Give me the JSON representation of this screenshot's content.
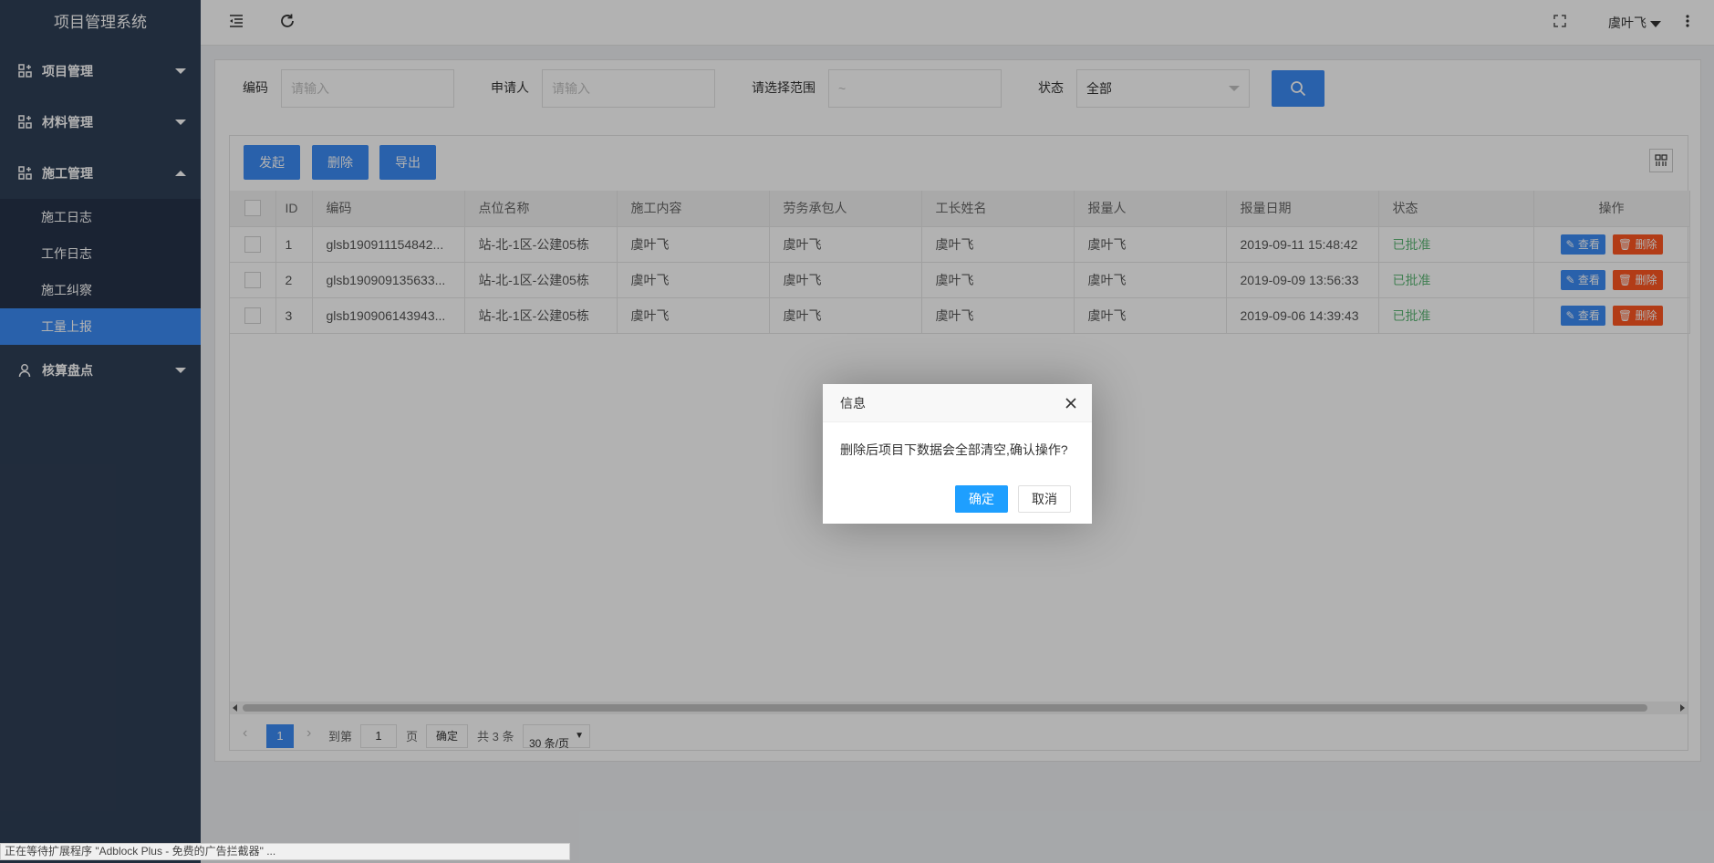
{
  "sidebar": {
    "brand": "项目管理系统",
    "groups": [
      {
        "label": "项目管理",
        "expanded": false,
        "icon": "grid-plus-icon"
      },
      {
        "label": "材料管理",
        "expanded": false,
        "icon": "grid-plus-icon"
      },
      {
        "label": "施工管理",
        "expanded": true,
        "icon": "grid-plus-icon"
      },
      {
        "label": "核算盘点",
        "expanded": false,
        "icon": "user-icon"
      }
    ],
    "sub_items": [
      {
        "label": "施工日志",
        "active": false
      },
      {
        "label": "工作日志",
        "active": false
      },
      {
        "label": "施工纠察",
        "active": false
      },
      {
        "label": "工量上报",
        "active": true
      }
    ]
  },
  "header": {
    "menu_toggle_icon": "menu-collapse-icon",
    "refresh_icon": "refresh-icon",
    "fullscreen_icon": "fullscreen-icon",
    "user_name": "虞叶飞",
    "more_icon": "more-vertical-icon"
  },
  "filters": {
    "code_label": "编码",
    "code_placeholder": "请输入",
    "applicant_label": "申请人",
    "applicant_placeholder": "请输入",
    "range_label": "请选择范围",
    "range_placeholder": "~",
    "status_label": "状态",
    "status_value": "全部"
  },
  "toolbar": {
    "launch_label": "发起",
    "delete_label": "删除",
    "export_label": "导出"
  },
  "table": {
    "headers": {
      "id": "ID",
      "code": "编码",
      "location": "点位名称",
      "content": "施工内容",
      "contractor": "劳务承包人",
      "foreman": "工长姓名",
      "reporter": "报量人",
      "date": "报量日期",
      "status": "状态",
      "actions": "操作"
    },
    "rows": [
      {
        "id": "1",
        "code": "glsb190911154842...",
        "location": "站-北-1区-公建05栋",
        "content": "虞叶飞",
        "contractor": "虞叶飞",
        "foreman": "虞叶飞",
        "reporter": "虞叶飞",
        "date": "2019-09-11 15:48:42",
        "status": "已批准"
      },
      {
        "id": "2",
        "code": "glsb190909135633...",
        "location": "站-北-1区-公建05栋",
        "content": "虞叶飞",
        "contractor": "虞叶飞",
        "foreman": "虞叶飞",
        "reporter": "虞叶飞",
        "date": "2019-09-09 13:56:33",
        "status": "已批准"
      },
      {
        "id": "3",
        "code": "glsb190906143943...",
        "location": "站-北-1区-公建05栋",
        "content": "虞叶飞",
        "contractor": "虞叶飞",
        "foreman": "虞叶飞",
        "reporter": "虞叶飞",
        "date": "2019-09-06 14:39:43",
        "status": "已批准"
      }
    ],
    "view_label": "查看",
    "delete_label": "删除",
    "status_color": "#5fb878"
  },
  "pager": {
    "current_page": "1",
    "goto_label": "到第",
    "goto_value": "1",
    "page_suffix": "页",
    "confirm_label": "确定",
    "total": "共 3 条",
    "page_size": "30 条/页"
  },
  "dialog": {
    "title": "信息",
    "message": "删除后项目下数据会全部清空,确认操作?",
    "ok_label": "确定",
    "cancel_label": "取消"
  },
  "statusbar": {
    "text": "正在等待扩展程序 \"Adblock Plus - 免费的广告拦截器\" ..."
  },
  "colors": {
    "sidebar_bg": "#2f3f56",
    "accent": "#3c8bf5",
    "danger": "#ff5722",
    "dialog_ok": "#1e9fff"
  }
}
